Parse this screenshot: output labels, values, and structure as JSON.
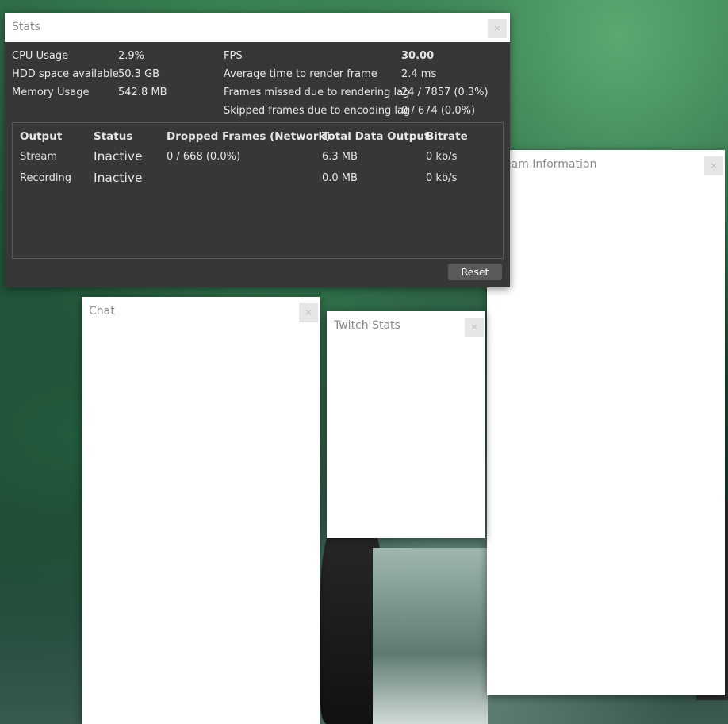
{
  "stats_window": {
    "title": "Stats",
    "close": "×",
    "left_stats": [
      {
        "label": "CPU Usage",
        "value": "2.9%"
      },
      {
        "label": "HDD space available",
        "value": "50.3 GB"
      },
      {
        "label": "Memory Usage",
        "value": "542.8 MB"
      }
    ],
    "right_stats": [
      {
        "label": "FPS",
        "value": "30.00"
      },
      {
        "label": "Average time to render frame",
        "value": "2.4 ms"
      },
      {
        "label": "Frames missed due to rendering lag",
        "value": "24 / 7857 (0.3%)"
      },
      {
        "label": "Skipped frames due to encoding lag",
        "value": "0 / 674 (0.0%)"
      }
    ],
    "outputs_table": {
      "headers": [
        "Output",
        "Status",
        "Dropped Frames (Network)",
        "Total Data Output",
        "Bitrate"
      ],
      "rows": [
        {
          "output": "Stream",
          "status": "Inactive",
          "dropped": "0 / 668 (0.0%)",
          "total": "6.3 MB",
          "bitrate": "0 kb/s"
        },
        {
          "output": "Recording",
          "status": "Inactive",
          "dropped": "",
          "total": "0.0 MB",
          "bitrate": "0 kb/s"
        }
      ]
    },
    "reset_label": "Reset"
  },
  "chat_window": {
    "title": "Chat",
    "close": "×"
  },
  "twitch_stats_window": {
    "title": "Twitch Stats",
    "close": "×"
  },
  "stream_info_window": {
    "title": "eam Information",
    "close": "×"
  }
}
